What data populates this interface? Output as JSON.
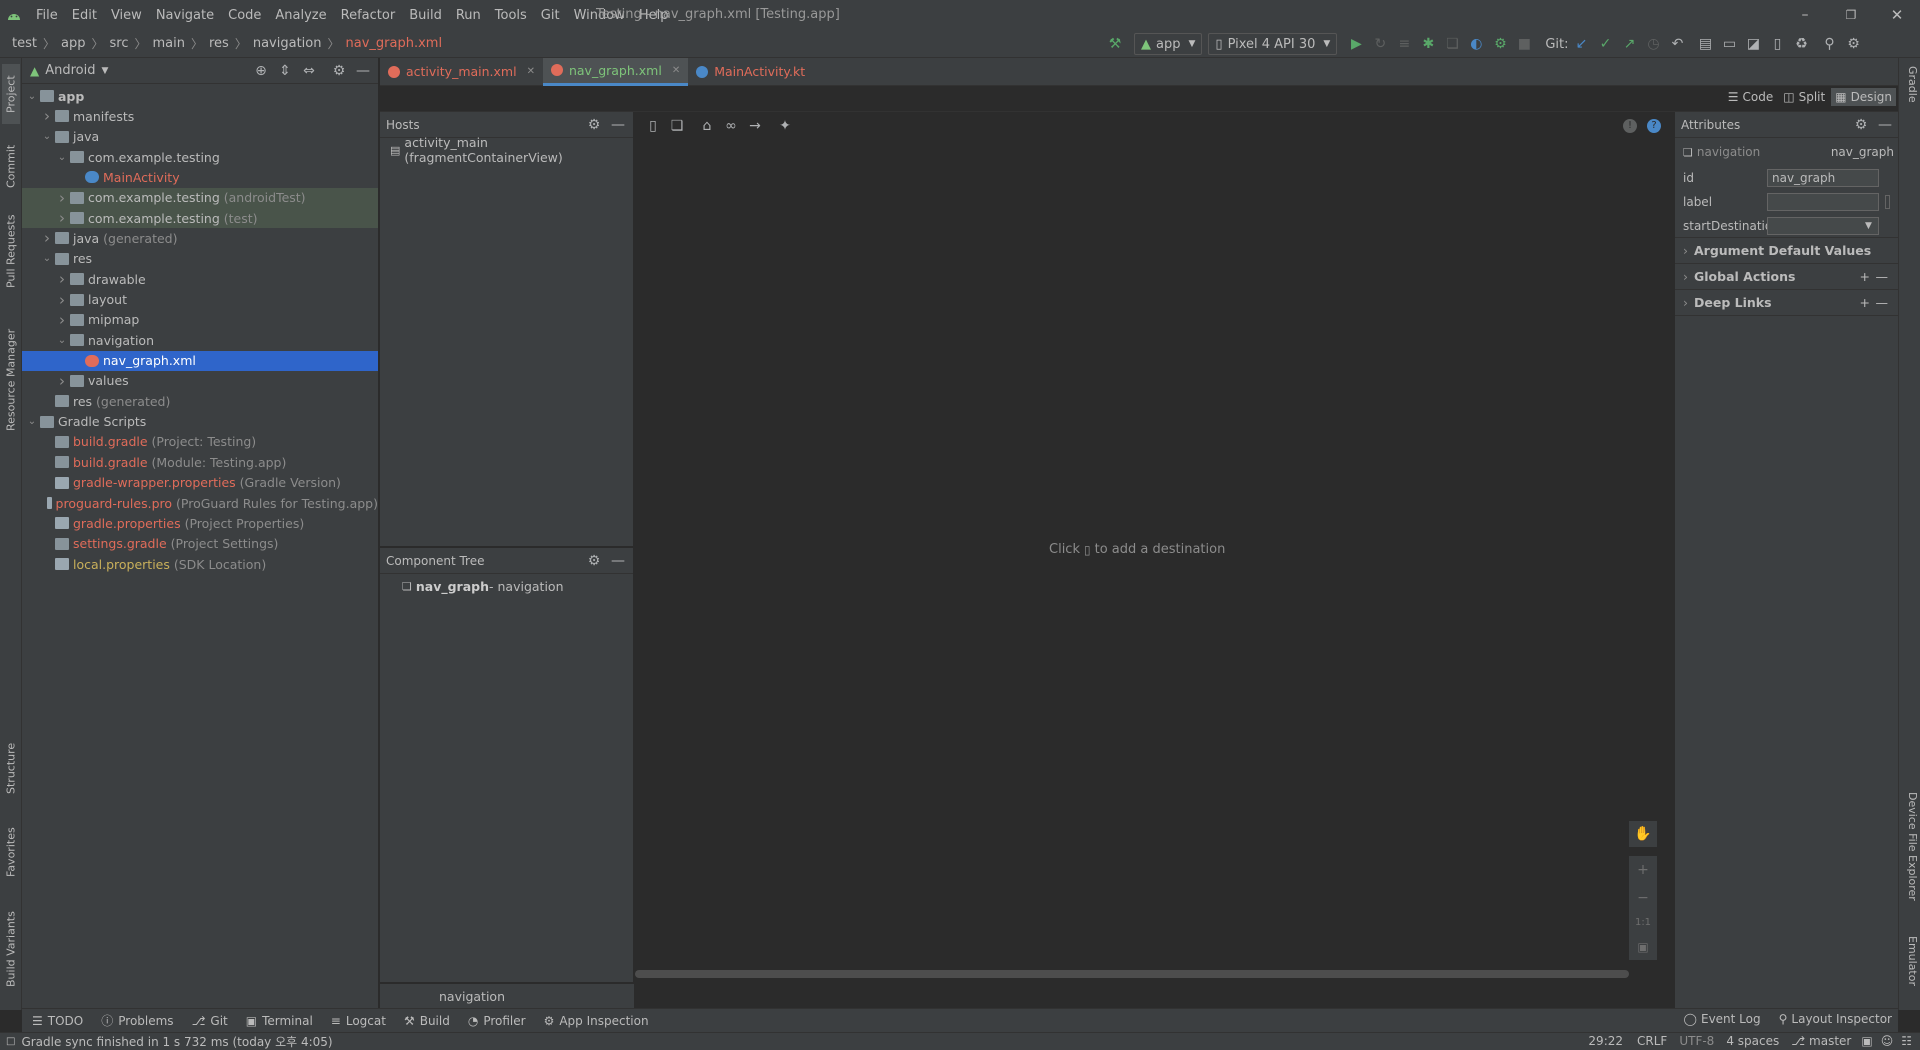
{
  "window": {
    "title": "Testing - nav_graph.xml [Testing.app]"
  },
  "menu": [
    "File",
    "Edit",
    "View",
    "Navigate",
    "Code",
    "Analyze",
    "Refactor",
    "Build",
    "Run",
    "Tools",
    "Git",
    "Window",
    "Help"
  ],
  "breadcrumb": [
    "test",
    "app",
    "src",
    "main",
    "res",
    "navigation",
    "nav_graph.xml"
  ],
  "toolbar": {
    "run_config": "app",
    "device": "Pixel 4 API 30",
    "git_label": "Git:"
  },
  "left_tools": [
    "Project",
    "Commit",
    "Pull Requests",
    "Resource Manager",
    "Structure",
    "Favorites",
    "Build Variants"
  ],
  "right_tools": [
    "Gradle",
    "Device File Explorer",
    "Emulator"
  ],
  "project_panel": {
    "view": "Android",
    "tree": [
      {
        "label": "app",
        "suffix": "",
        "depth": 0,
        "arrow": "open",
        "icon": "folder",
        "style": "bold"
      },
      {
        "label": "manifests",
        "suffix": "",
        "depth": 1,
        "arrow": "closed",
        "icon": "folder",
        "style": ""
      },
      {
        "label": "java",
        "suffix": "",
        "depth": 1,
        "arrow": "open",
        "icon": "folder",
        "style": ""
      },
      {
        "label": "com.example.testing",
        "suffix": "",
        "depth": 2,
        "arrow": "open",
        "icon": "package",
        "style": ""
      },
      {
        "label": "MainActivity",
        "suffix": "",
        "depth": 3,
        "arrow": "",
        "icon": "kotlin",
        "style": "red"
      },
      {
        "label": "com.example.testing",
        "suffix": " (androidTest)",
        "depth": 2,
        "arrow": "closed",
        "icon": "package",
        "style": "green"
      },
      {
        "label": "com.example.testing",
        "suffix": " (test)",
        "depth": 2,
        "arrow": "closed",
        "icon": "package",
        "style": "green"
      },
      {
        "label": "java",
        "suffix": " (generated)",
        "depth": 1,
        "arrow": "closed",
        "icon": "folder",
        "style": ""
      },
      {
        "label": "res",
        "suffix": "",
        "depth": 1,
        "arrow": "open",
        "icon": "folder",
        "style": ""
      },
      {
        "label": "drawable",
        "suffix": "",
        "depth": 2,
        "arrow": "closed",
        "icon": "folder",
        "style": ""
      },
      {
        "label": "layout",
        "suffix": "",
        "depth": 2,
        "arrow": "closed",
        "icon": "folder",
        "style": ""
      },
      {
        "label": "mipmap",
        "suffix": "",
        "depth": 2,
        "arrow": "closed",
        "icon": "folder",
        "style": ""
      },
      {
        "label": "navigation",
        "suffix": "",
        "depth": 2,
        "arrow": "open",
        "icon": "folder",
        "style": ""
      },
      {
        "label": "nav_graph.xml",
        "suffix": "",
        "depth": 3,
        "arrow": "",
        "icon": "xml",
        "style": "selected"
      },
      {
        "label": "values",
        "suffix": "",
        "depth": 2,
        "arrow": "closed",
        "icon": "folder",
        "style": ""
      },
      {
        "label": "res",
        "suffix": " (generated)",
        "depth": 1,
        "arrow": "",
        "icon": "folder",
        "style": ""
      },
      {
        "label": "Gradle Scripts",
        "suffix": "",
        "depth": 0,
        "arrow": "open",
        "icon": "gradle",
        "style": ""
      },
      {
        "label": "build.gradle",
        "suffix": " (Project: Testing)",
        "depth": 1,
        "arrow": "",
        "icon": "gradle",
        "style": "red"
      },
      {
        "label": "build.gradle",
        "suffix": " (Module: Testing.app)",
        "depth": 1,
        "arrow": "",
        "icon": "gradle",
        "style": "red"
      },
      {
        "label": "gradle-wrapper.properties",
        "suffix": " (Gradle Version)",
        "depth": 1,
        "arrow": "",
        "icon": "props",
        "style": "red"
      },
      {
        "label": "proguard-rules.pro",
        "suffix": " (ProGuard Rules for Testing.app)",
        "depth": 1,
        "arrow": "",
        "icon": "props",
        "style": "red"
      },
      {
        "label": "gradle.properties",
        "suffix": " (Project Properties)",
        "depth": 1,
        "arrow": "",
        "icon": "props",
        "style": "red"
      },
      {
        "label": "settings.gradle",
        "suffix": " (Project Settings)",
        "depth": 1,
        "arrow": "",
        "icon": "gradle",
        "style": "red"
      },
      {
        "label": "local.properties",
        "suffix": " (SDK Location)",
        "depth": 1,
        "arrow": "",
        "icon": "props",
        "style": "yellow"
      }
    ]
  },
  "editor_tabs": [
    {
      "label": "activity_main.xml",
      "active": false
    },
    {
      "label": "nav_graph.xml",
      "active": true
    },
    {
      "label": "MainActivity.kt",
      "active": false
    }
  ],
  "view_modes": {
    "code": "Code",
    "split": "Split",
    "design": "Design"
  },
  "hosts": {
    "title": "Hosts",
    "item": "activity_main (fragmentContainerView)"
  },
  "component_tree": {
    "title": "Component Tree",
    "root_name": "nav_graph",
    "root_type": " - navigation"
  },
  "canvas": {
    "hint_prefix": "Click",
    "hint_suffix": "to add a destination"
  },
  "bottom_label": "navigation",
  "attributes": {
    "title": "Attributes",
    "type": "navigation",
    "name": "nav_graph",
    "fields": [
      {
        "label": "id",
        "value": "nav_graph"
      },
      {
        "label": "label",
        "value": ""
      },
      {
        "label": "startDestination",
        "value": ""
      }
    ],
    "sections": [
      "Argument Default Values",
      "Global Actions",
      "Deep Links"
    ]
  },
  "bottom_tools": [
    "TODO",
    "Problems",
    "Git",
    "Terminal",
    "Logcat",
    "Build",
    "Profiler",
    "App Inspection"
  ],
  "bottom_tools_right": [
    "Event Log",
    "Layout Inspector"
  ],
  "status": {
    "message": "Gradle sync finished in 1 s 732 ms (today 오후 4:05)",
    "position": "29:22",
    "line_sep": "CRLF",
    "encoding": "UTF-8",
    "indent": "4 spaces",
    "branch": "master"
  },
  "colors": {
    "accent": "#4a88c7",
    "selection": "#2f65ca",
    "vcs_red": "#e06c5a",
    "run_green": "#59a869"
  }
}
